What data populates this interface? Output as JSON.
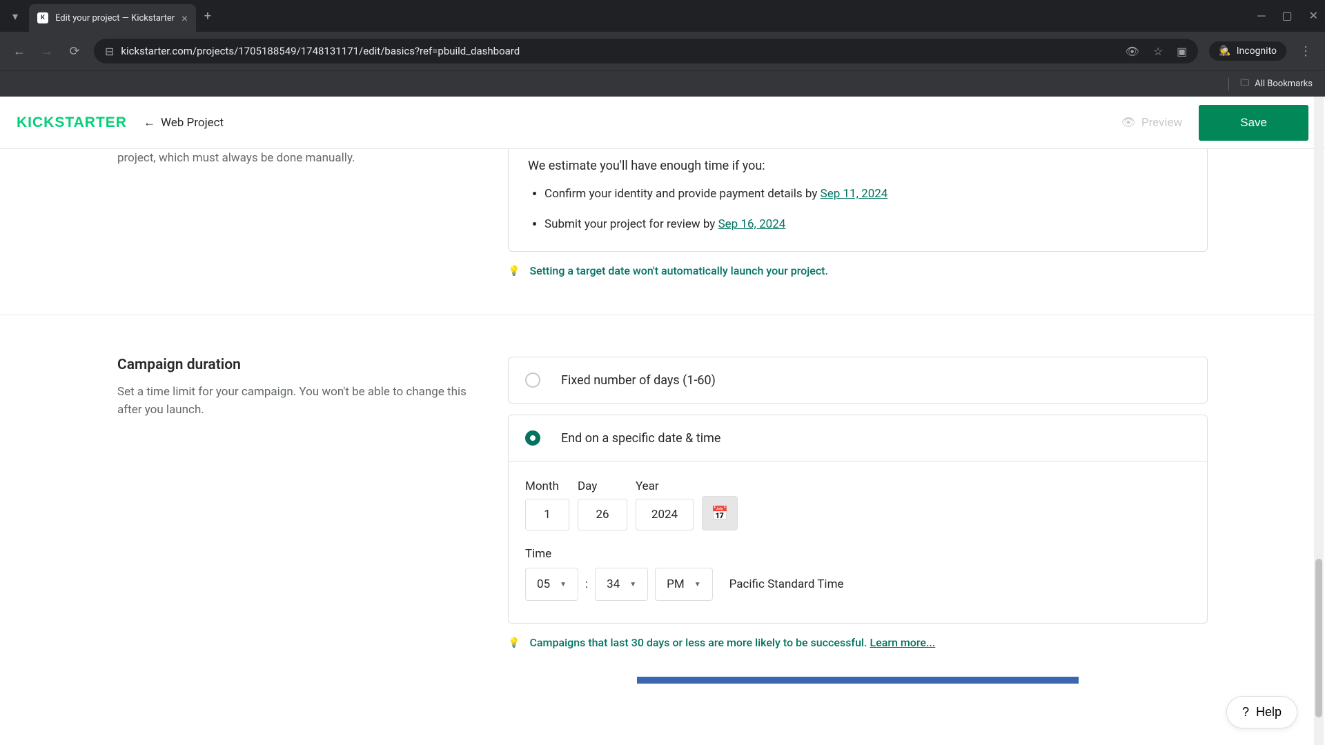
{
  "browser": {
    "tab_title": "Edit your project — Kickstarter",
    "url": "kickstarter.com/projects/1705188549/1748131171/edit/basics?ref=pbuild_dashboard",
    "incognito": "Incognito",
    "all_bookmarks": "All Bookmarks"
  },
  "header": {
    "logo": "KICKSTARTER",
    "back_label": "Web Project",
    "preview": "Preview",
    "save": "Save"
  },
  "launch": {
    "desc_fragment": "project, which must always be done manually.",
    "estimate_title": "We estimate you'll have enough time if you:",
    "items": [
      {
        "text": "Confirm your identity and provide payment details by ",
        "link": "Sep 11, 2024"
      },
      {
        "text": "Submit your project for review by ",
        "link": "Sep 16, 2024"
      }
    ],
    "tip": "Setting a target date won't automatically launch your project."
  },
  "duration": {
    "title": "Campaign duration",
    "desc": "Set a time limit for your campaign. You won't be able to change this after you launch.",
    "option_fixed": "Fixed number of days (1-60)",
    "option_specific": "End on a specific date & time",
    "date": {
      "month_label": "Month",
      "day_label": "Day",
      "year_label": "Year",
      "month": "1",
      "day": "26",
      "year": "2024"
    },
    "time_label": "Time",
    "time": {
      "hour": "05",
      "minute": "34",
      "period": "PM",
      "tz": "Pacific Standard Time"
    },
    "tip": "Campaigns that last 30 days or less are more likely to be successful. ",
    "tip_link": "Learn more..."
  },
  "help": "Help"
}
